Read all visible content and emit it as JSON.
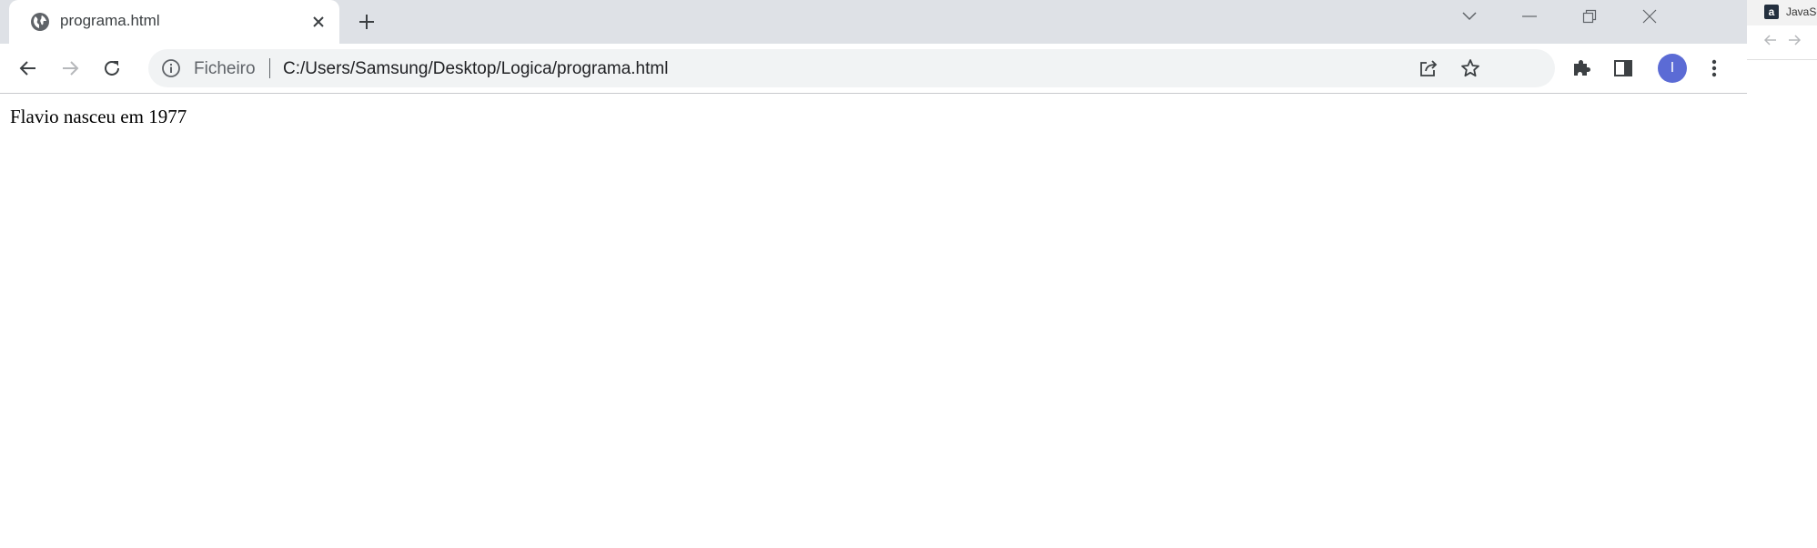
{
  "tab": {
    "title": "programa.html"
  },
  "omnibox": {
    "scheme_label": "Ficheiro",
    "url": "C:/Users/Samsung/Desktop/Logica/programa.html"
  },
  "profile": {
    "initial": "I"
  },
  "page": {
    "text": "Flavio nasceu em 1977"
  },
  "side_window": {
    "favicon_letter": "a",
    "title": "JavaScr"
  },
  "colors": {
    "tabstrip": "#dee1e6",
    "omnibox": "#f1f3f4",
    "avatar": "#5b6bd5"
  }
}
